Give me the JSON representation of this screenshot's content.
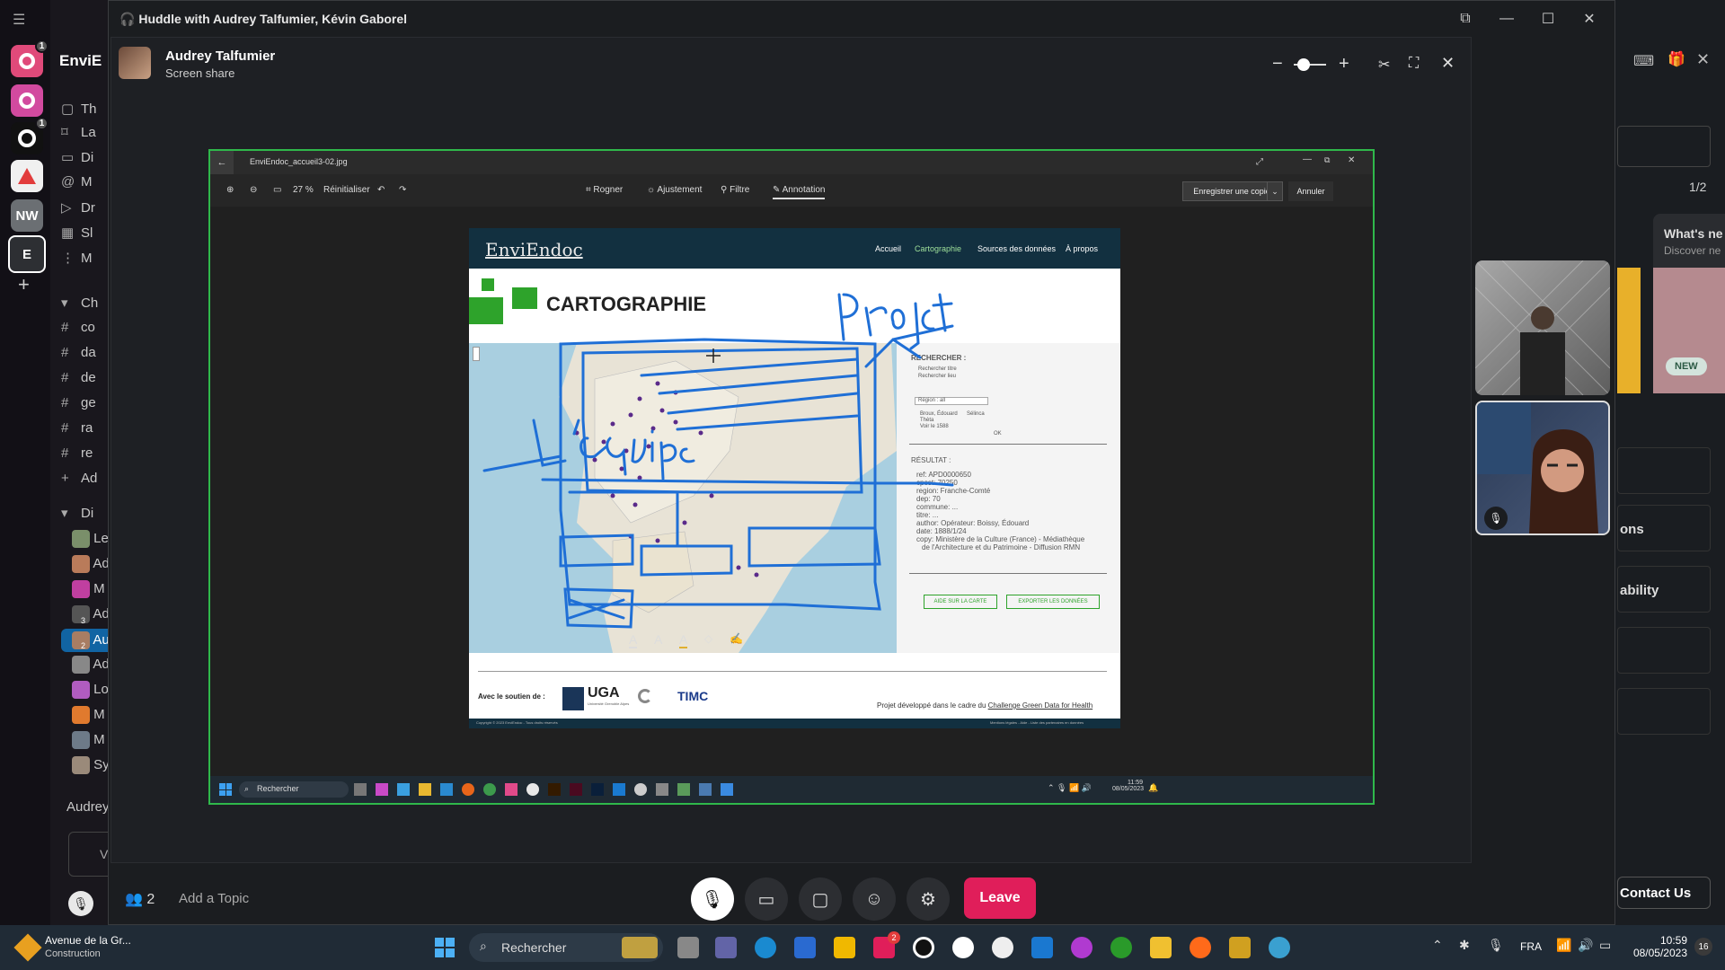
{
  "rail": {
    "badges": [
      "1",
      "1"
    ],
    "workspace_nw": "NW",
    "workspace_e": "E",
    "add": "+"
  },
  "sidebar": {
    "workspace_name": "EnviE",
    "items": [
      "Th",
      "La",
      "Di",
      "M",
      "Dr",
      "Sl",
      "M"
    ],
    "channels_header": "Ch",
    "channels": [
      "co",
      "da",
      "de",
      "ge",
      "ra",
      "re"
    ],
    "add_channel": "Ad",
    "dms_header": "Di",
    "dms": [
      "Le",
      "Ad",
      "M",
      "Ad",
      "Au",
      "Ad",
      "Lo",
      "M",
      "M",
      "Sy"
    ],
    "dm_badges": [
      "3",
      "2"
    ],
    "footer_name": "Audrey",
    "composer_text": "V"
  },
  "huddle": {
    "title": "Huddle with Audrey Talfumier, Kévin Gaborel",
    "presenter": "Audrey Talfumier",
    "presenter_sub": "Screen share",
    "participant_count": "2",
    "topic_placeholder": "Add a Topic",
    "leave_label": "Leave"
  },
  "photo_app": {
    "filename": "EnviEndoc_accueil3-02.jpg",
    "zoom": "27 %",
    "reset": "Réinitialiser",
    "tools": [
      "Rogner",
      "Ajustement",
      "Filtre",
      "Annotation"
    ],
    "save": "Enregistrer une copie",
    "cancel": "Annuler"
  },
  "website": {
    "logo": "EnviEndoc",
    "nav": [
      "Accueil",
      "Cartographie",
      "Sources des données",
      "À propos"
    ],
    "heading": "CARTOGRAPHIE",
    "panel_title": "RECHERCHER :",
    "panel_fields": [
      "Rechercher titre",
      "Rechercher lieu",
      "Région : all",
      "Broux, Édouard",
      "Thèta",
      "Sélinca",
      "Voir le 1588",
      "OK"
    ],
    "result_title": "RÉSULTAT :",
    "result_lines": [
      "ref: APD0000650",
      "cpost: 70250",
      "region: Franche-Comté",
      "dep: 70",
      "commune: ...",
      "titre: ...",
      "author: Opérateur: Boissy, Édouard",
      "date: 1888/1/24",
      "copy: Ministère de la Culture (France) - Médiathèque",
      "de l'Architecture et du Patrimoine - Diffusion RMN"
    ],
    "btn_help": "AIDE SUR LA CARTE",
    "btn_export": "EXPORTER LES DONNÉES",
    "support": "Avec le soutien de :",
    "sponsors": [
      "UGA",
      "TIMC"
    ],
    "uga_sub": "Université Grenoble Alpes",
    "project_prefix": "Projet développé dans le cadre du ",
    "project_link": "Challenge Green Data for Health",
    "copyright": "Copyright © 2023 EnviEndoc - Tous droits réservés",
    "legal": "Mentions légales - Aide - Liste des partenaires en données"
  },
  "annotations": {
    "handwriting_1": "Projet",
    "handwriting_2": "l'équipe"
  },
  "inner_taskbar": {
    "search": "Rechercher",
    "time": "11:59",
    "date": "08/05/2023"
  },
  "right_panel": {
    "page": "1/2",
    "whats_new": "What's ne",
    "discover": "Discover ne",
    "new_badge": "NEW",
    "frag_ons": "ons",
    "frag_ability": "ability",
    "contact": "Contact Us"
  },
  "taskbar": {
    "weather_title": "Avenue de la Gr...",
    "weather_sub": "Construction",
    "search": "Rechercher",
    "lang": "FRA",
    "time": "10:59",
    "date": "08/05/2023",
    "notif": "16",
    "app_badge": "2"
  },
  "colors": {
    "accent_green": "#2fb84b",
    "leave": "#e01e5a",
    "annotation_blue": "#1f6fd6",
    "site_nav": "#123040",
    "site_green": "#2ea32b"
  }
}
